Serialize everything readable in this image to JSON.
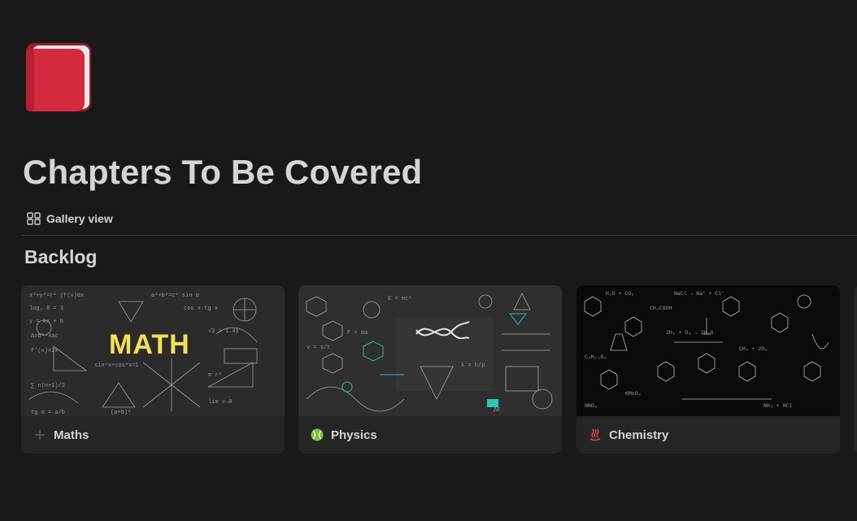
{
  "page": {
    "icon": "red-book-icon",
    "title": "Chapters To Be Covered"
  },
  "view": {
    "label": "Gallery view",
    "icon": "gallery-grid-icon"
  },
  "group": {
    "title": "Backlog"
  },
  "cards": [
    {
      "label": "Maths",
      "icon": "plus-icon",
      "cover_text": "MATH",
      "cover": "chalkboard-math-formulas"
    },
    {
      "label": "Physics",
      "icon": "green-ball-icon",
      "cover": "chalkboard-physics-dna"
    },
    {
      "label": "Chemistry",
      "icon": "hot-springs-icon",
      "cover": "chalkboard-chemistry-molecules"
    }
  ],
  "colors": {
    "background": "#191919",
    "card": "#252525",
    "text": "#d4d4d4",
    "book_red": "#d42a3e",
    "math_yellow": "#f2e05a",
    "teal_accent": "#2ec4b6"
  }
}
